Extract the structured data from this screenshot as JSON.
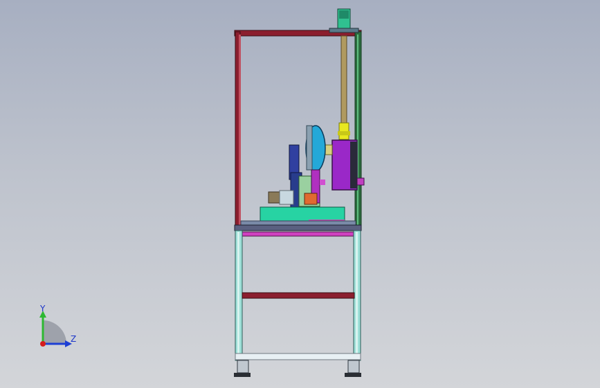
{
  "triad": {
    "y_label": "Y",
    "z_label": "Z",
    "colors": {
      "x": "#d41d1d",
      "y": "#2db832",
      "z": "#1d3fd4"
    }
  },
  "model": {
    "frame_colors": {
      "upper_bar": "#8b1e2e",
      "post": "#8b1e2e",
      "lower_post": "#9fe0d8",
      "magenta_bar": "#d040c0",
      "mid_bar": "#8b1e2e"
    },
    "part_colors": {
      "motor_body": "#9a28c8",
      "reel": "#24a8d8",
      "base_plate": "#27d3a3",
      "shaft": "#b09a60",
      "shaft_coupling": "#e8e820",
      "top_block": "#30c090"
    }
  }
}
